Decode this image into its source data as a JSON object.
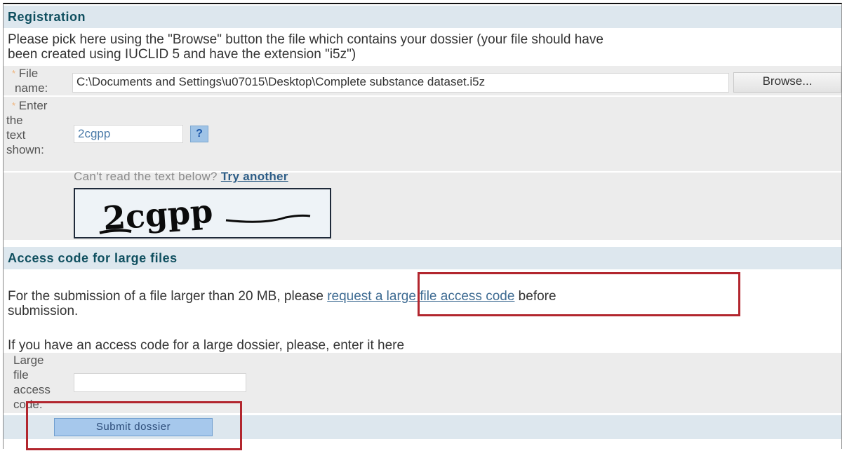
{
  "registration": {
    "heading": "Registration",
    "instructions_line1": "Please pick here using the \"Browse\" button the file which contains your dossier (your file should have",
    "instructions_line2": "been created using IUCLID 5 and have the extension \"i5z\")",
    "required_marker": "*",
    "file_label_1": "File",
    "file_label_2": "name:",
    "file_value": "C:\\Documents and Settings\\u07015\\Desktop\\Complete substance dataset.i5z",
    "browse_label": "Browse...",
    "captcha_label_1": "Enter",
    "captcha_label_2": "the",
    "captcha_label_3": "text",
    "captcha_label_4": "shown:",
    "captcha_value": "2cgpp",
    "help_label": "?",
    "cant_read_text": "Can't read the text below?",
    "try_another": "Try another",
    "captcha_image_text": "2cgpp"
  },
  "access_code": {
    "heading": "Access code for large files",
    "large_file_text_before": "For the submission of a file larger than 20 MB, please ",
    "large_file_link": "request a large file access code",
    "large_file_text_after": " before",
    "large_file_text_line2": "submission.",
    "enter_code_text": "If you have an access code for a large dossier, please, enter it here",
    "code_label_1": "Large",
    "code_label_2": "file",
    "code_label_3": "access",
    "code_label_4": "code:",
    "code_value": "",
    "submit_label": "Submit dossier"
  },
  "colors": {
    "section_header_bg": "#dde7ee",
    "section_header_text": "#0f4f5f",
    "highlight_border": "#b2262e",
    "submit_bg": "#a6c8ec"
  }
}
